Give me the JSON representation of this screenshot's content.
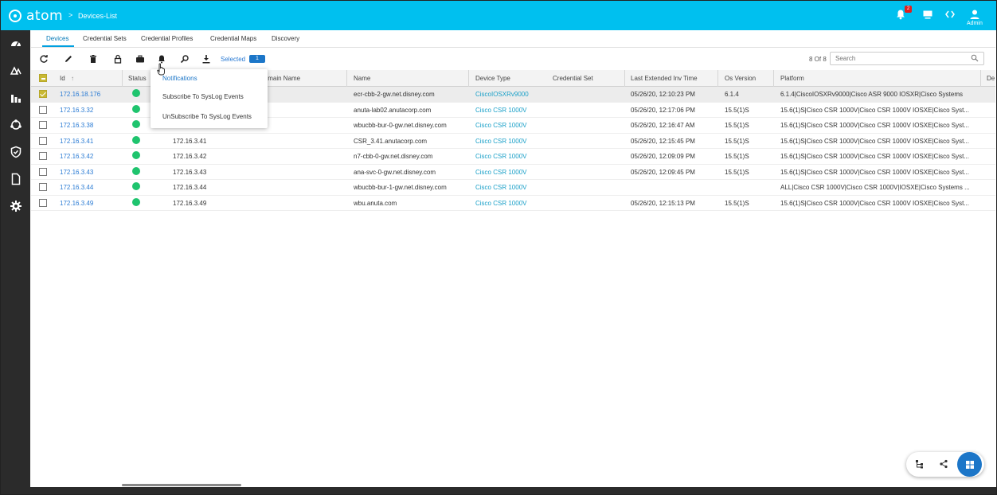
{
  "app": {
    "name": "atom",
    "breadcrumb": "Devices-List",
    "admin_label": "Admin",
    "notification_count": "2"
  },
  "sidebar": {
    "items": [
      "dashboard-icon",
      "devices-icon",
      "analytics-icon",
      "topology-icon",
      "security-icon",
      "documents-icon",
      "settings-icon"
    ]
  },
  "tabs": [
    {
      "label": "Devices",
      "active": true
    },
    {
      "label": "Credential Sets",
      "active": false
    },
    {
      "label": "Credential Profiles",
      "active": false
    },
    {
      "label": "Credential Maps",
      "active": false
    },
    {
      "label": "Discovery",
      "active": false
    }
  ],
  "toolbar": {
    "selected_label": "Selected",
    "selected_count": "1",
    "count_label": "8 Of 8",
    "search_placeholder": "Search"
  },
  "table": {
    "headers": {
      "id": "Id",
      "status": "Status",
      "domain": "Domain Name",
      "name": "Name",
      "device_type": "Device Type",
      "credential_set": "Credential Set",
      "last_time": "Last Extended Inv Time",
      "os_version": "Os Version",
      "platform": "Platform",
      "extra": "De"
    },
    "rows": [
      {
        "id": "172.16.18.176",
        "domain": "",
        "name": "ecr-cbb-2-gw.net.disney.com",
        "device_type": "CiscoIOSXRv9000",
        "last_time": "05/26/20, 12:10:23 PM",
        "os": "6.1.4",
        "platform": "6.1.4|CiscoIOSXRv9000|Cisco ASR 9000 IOSXR|Cisco Systems",
        "selected": true
      },
      {
        "id": "172.16.3.32",
        "domain": "",
        "name": "anuta-lab02.anutacorp.com",
        "device_type": "Cisco CSR 1000V",
        "last_time": "05/26/20, 12:17:06 PM",
        "os": "15.5(1)S",
        "platform": "15.6(1)S|Cisco CSR 1000V|Cisco CSR 1000V IOSXE|Cisco Syst...",
        "selected": false
      },
      {
        "id": "172.16.3.38",
        "domain": "",
        "name": "wbucbb-bur-0-gw.net.disney.com",
        "device_type": "Cisco CSR 1000V",
        "last_time": "05/26/20, 12:16:47 AM",
        "os": "15.5(1)S",
        "platform": "15.6(1)S|Cisco CSR 1000V|Cisco CSR 1000V IOSXE|Cisco Syst...",
        "selected": false
      },
      {
        "id": "172.16.3.41",
        "domain": "172.16.3.41",
        "name": "CSR_3.41.anutacorp.com",
        "device_type": "Cisco CSR 1000V",
        "last_time": "05/26/20, 12:15:45 PM",
        "os": "15.5(1)S",
        "platform": "15.6(1)S|Cisco CSR 1000V|Cisco CSR 1000V IOSXE|Cisco Syst...",
        "selected": false
      },
      {
        "id": "172.16.3.42",
        "domain": "172.16.3.42",
        "name": "n7-cbb-0-gw.net.disney.com",
        "device_type": "Cisco CSR 1000V",
        "last_time": "05/26/20, 12:09:09 PM",
        "os": "15.5(1)S",
        "platform": "15.6(1)S|Cisco CSR 1000V|Cisco CSR 1000V IOSXE|Cisco Syst...",
        "selected": false
      },
      {
        "id": "172.16.3.43",
        "domain": "172.16.3.43",
        "name": "ana-svc-0-gw.net.disney.com",
        "device_type": "Cisco CSR 1000V",
        "last_time": "05/26/20, 12:09:45 PM",
        "os": "15.5(1)S",
        "platform": "15.6(1)S|Cisco CSR 1000V|Cisco CSR 1000V IOSXE|Cisco Syst...",
        "selected": false
      },
      {
        "id": "172.16.3.44",
        "domain": "172.16.3.44",
        "name": "wbucbb-bur-1-gw.net.disney.com",
        "device_type": "Cisco CSR 1000V",
        "last_time": "",
        "os": "",
        "platform": "ALL|Cisco CSR 1000V|Cisco CSR 1000V|IOSXE|Cisco Systems ...",
        "selected": false
      },
      {
        "id": "172.16.3.49",
        "domain": "172.16.3.49",
        "name": "wbu.anuta.com",
        "device_type": "Cisco CSR 1000V",
        "last_time": "05/26/20, 12:15:13 PM",
        "os": "15.5(1)S",
        "platform": "15.6(1)S|Cisco CSR 1000V|Cisco CSR 1000V IOSXE|Cisco Syst...",
        "selected": false
      }
    ]
  },
  "notifications_menu": {
    "header": "Notifications",
    "items": [
      "Subscribe To SysLog Events",
      "UnSubscribe To SysLog Events"
    ]
  },
  "colors": {
    "header": "#00c0ef",
    "sidebar": "#2b2b2b",
    "status_up": "#1fc46e",
    "link": "#2a7bd4"
  }
}
